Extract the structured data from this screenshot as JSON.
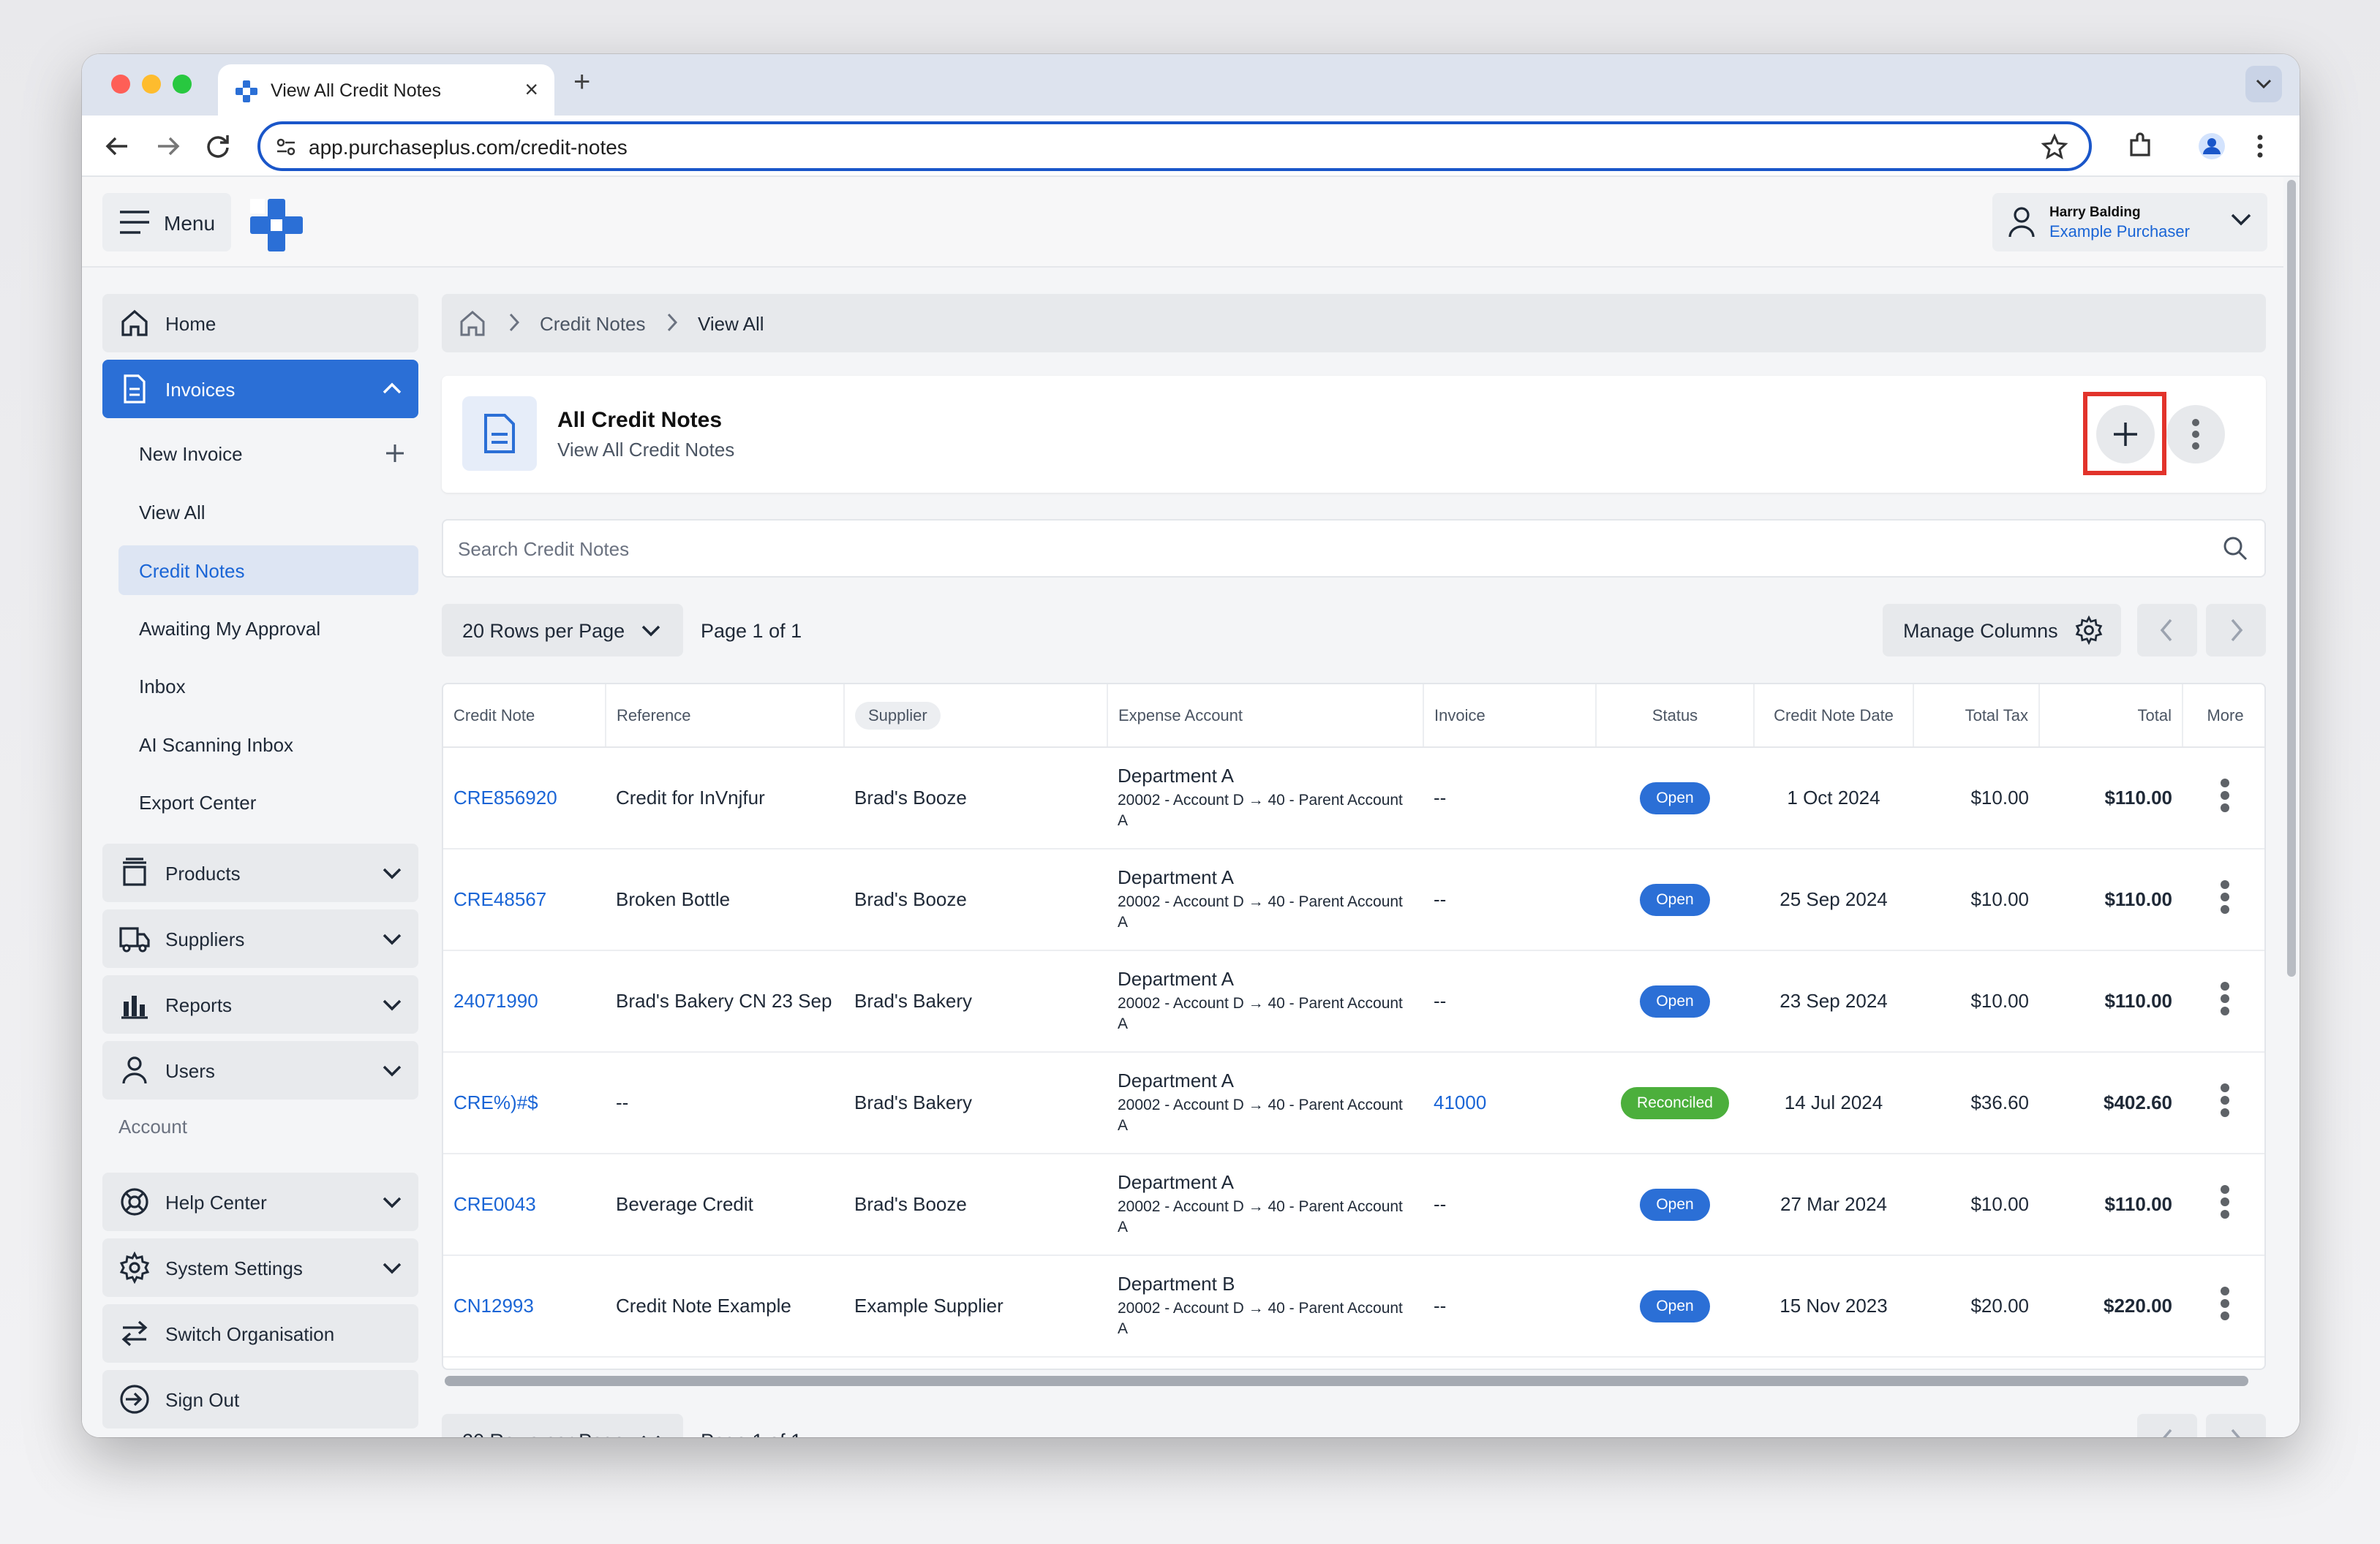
{
  "browser": {
    "tab_title": "View All Credit Notes",
    "url": "app.purchaseplus.com/credit-notes"
  },
  "header": {
    "menu_label": "Menu",
    "user_name": "Harry Balding",
    "user_role": "Example Purchaser"
  },
  "sidebar": {
    "home": "Home",
    "invoices": "Invoices",
    "sub_items": [
      "New Invoice",
      "View All",
      "Credit Notes",
      "Awaiting My Approval",
      "Inbox",
      "AI Scanning Inbox",
      "Export Center"
    ],
    "products": "Products",
    "suppliers": "Suppliers",
    "reports": "Reports",
    "users": "Users",
    "account_label": "Account",
    "help_center": "Help Center",
    "system_settings": "System Settings",
    "switch_org": "Switch Organisation",
    "sign_out": "Sign Out"
  },
  "breadcrumb": [
    "Credit Notes",
    "View All"
  ],
  "page": {
    "title": "All Credit Notes",
    "subtitle": "View All Credit Notes",
    "search_placeholder": "Search Credit Notes",
    "rows_per_page": "20 Rows per Page",
    "page_info": "Page 1 of 1",
    "manage_columns": "Manage Columns"
  },
  "table": {
    "headers": [
      "Credit Note",
      "Reference",
      "Supplier",
      "Expense Account",
      "Invoice",
      "Status",
      "Credit Note Date",
      "Total Tax",
      "Total",
      "More"
    ],
    "rows": [
      {
        "credit_note": "CRE856920",
        "reference": "Credit for InVnjfur",
        "supplier": "Brad's Booze",
        "account": "Department A",
        "account_sub": "20002 - Account D → 40 - Parent Account A",
        "invoice": "--",
        "status": "Open",
        "date": "1 Oct 2024",
        "tax": "$10.00",
        "total": "$110.00"
      },
      {
        "credit_note": "CRE48567",
        "reference": "Broken Bottle",
        "supplier": "Brad's Booze",
        "account": "Department A",
        "account_sub": "20002 - Account D → 40 - Parent Account A",
        "invoice": "--",
        "status": "Open",
        "date": "25 Sep 2024",
        "tax": "$10.00",
        "total": "$110.00"
      },
      {
        "credit_note": "24071990",
        "reference": "Brad's Bakery CN 23 Sep",
        "supplier": "Brad's Bakery",
        "account": "Department A",
        "account_sub": "20002 - Account D → 40 - Parent Account A",
        "invoice": "--",
        "status": "Open",
        "date": "23 Sep 2024",
        "tax": "$10.00",
        "total": "$110.00"
      },
      {
        "credit_note": "CRE%)#$",
        "reference": "--",
        "supplier": "Brad's Bakery",
        "account": "Department A",
        "account_sub": "20002 - Account D → 40 - Parent Account A",
        "invoice": "41000",
        "status": "Reconciled",
        "date": "14 Jul 2024",
        "tax": "$36.60",
        "total": "$402.60"
      },
      {
        "credit_note": "CRE0043",
        "reference": "Beverage Credit",
        "supplier": "Brad's Booze",
        "account": "Department A",
        "account_sub": "20002 - Account D → 40 - Parent Account A",
        "invoice": "--",
        "status": "Open",
        "date": "27 Mar 2024",
        "tax": "$10.00",
        "total": "$110.00"
      },
      {
        "credit_note": "CN12993",
        "reference": "Credit Note Example",
        "supplier": "Example Supplier",
        "account": "Department B",
        "account_sub": "20002 - Account D → 40 - Parent Account A",
        "invoice": "--",
        "status": "Open",
        "date": "15 Nov 2023",
        "tax": "$20.00",
        "total": "$220.00"
      }
    ]
  },
  "colors": {
    "primary": "#2b6fd6",
    "link": "#1a65d6",
    "reconciled": "#4caf3c",
    "highlight": "#e2332b"
  }
}
